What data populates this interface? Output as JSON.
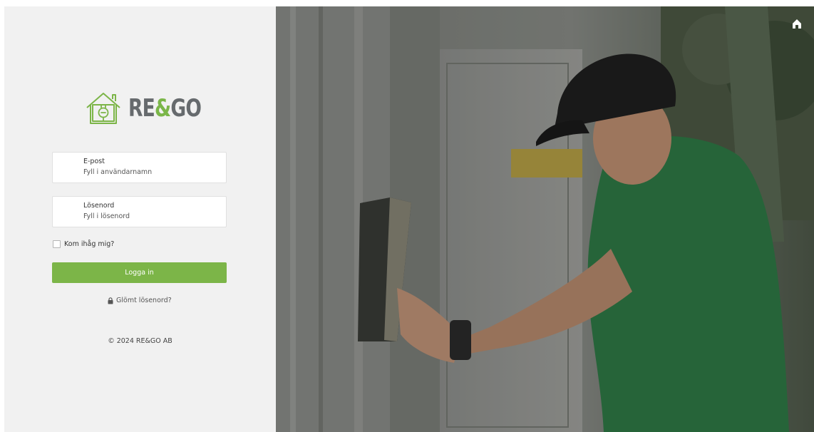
{
  "brand": {
    "logo_parts": [
      "RE",
      "&",
      "GO"
    ],
    "colors": {
      "accent": "#7cb548",
      "logo_gray": "#666a6d"
    }
  },
  "form": {
    "email": {
      "label": "E-post",
      "placeholder": "Fyll i användarnamn"
    },
    "password": {
      "label": "Lösenord",
      "placeholder": "Fyll i lösenord"
    },
    "remember_label": "Kom ihåg mig?",
    "submit_label": "Logga in",
    "forgot_label": "Glömt lösenord?"
  },
  "footer": {
    "copyright": "© 2024 RE&GO AB"
  },
  "icons": {
    "forgot": "lock-icon",
    "home": "home-icon",
    "logo": "house-plug-icon"
  }
}
